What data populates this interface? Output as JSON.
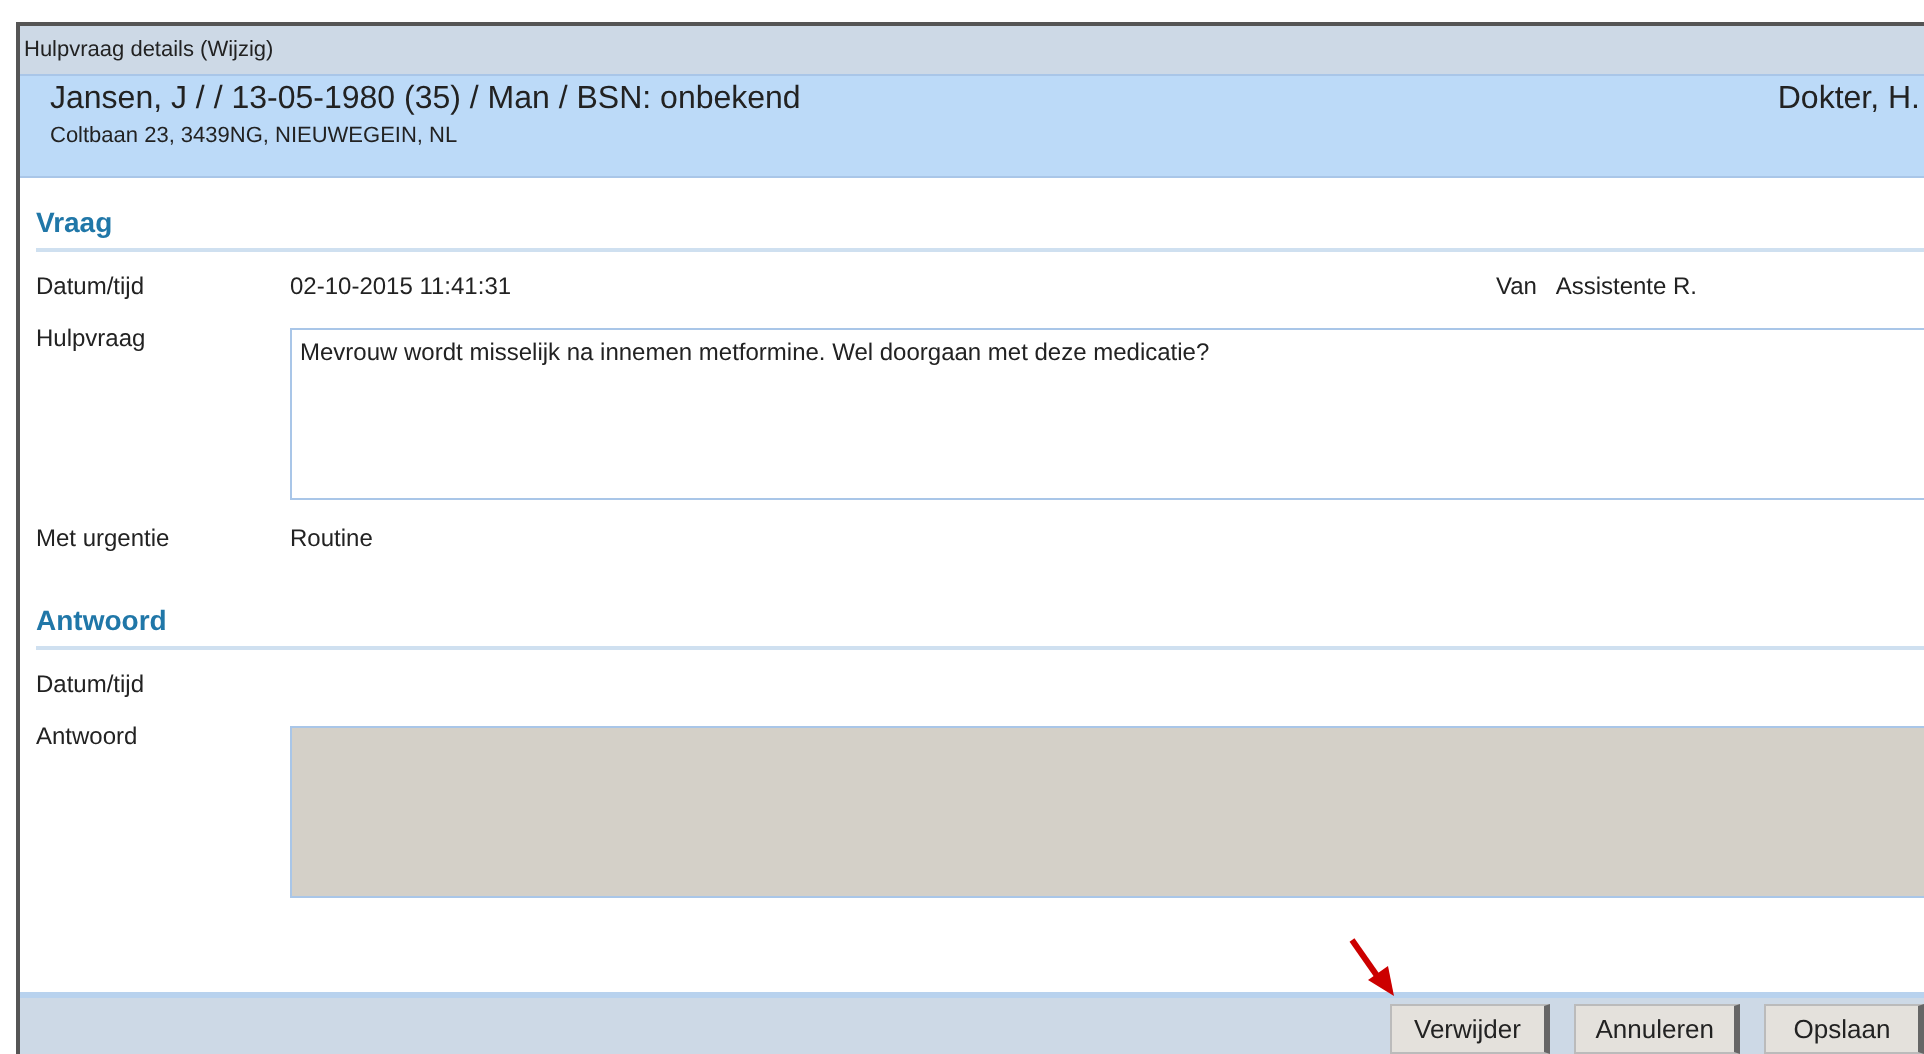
{
  "window": {
    "title": "Hulpvraag details (Wijzig)"
  },
  "patient": {
    "name_line": "Jansen, J / / 13-05-1980 (35) / Man / BSN: onbekend",
    "address": "Coltbaan 23, 3439NG, NIEUWEGEIN, NL",
    "doctor": "Dokter, H."
  },
  "sections": [
    {
      "heading": "Vraag",
      "rows": [
        {
          "kind": "text",
          "label": "Datum/tijd",
          "value": "02-10-2015 11:41:31",
          "extra_label": "Van",
          "extra_value": "Assistente R."
        },
        {
          "kind": "area",
          "label": "Hulpvraag",
          "value": "Mevrouw wordt misselijk na innemen metformine. Wel doorgaan met deze medicatie?",
          "disabled": false
        },
        {
          "kind": "text",
          "label": "Met urgentie",
          "value": "Routine"
        }
      ]
    },
    {
      "heading": "Antwoord",
      "rows": [
        {
          "kind": "text",
          "label": "Datum/tijd"
        },
        {
          "kind": "area",
          "label": "Antwoord",
          "disabled": true
        }
      ]
    }
  ],
  "buttons": [
    "Verwijder",
    "Annuleren",
    "Opslaan"
  ]
}
